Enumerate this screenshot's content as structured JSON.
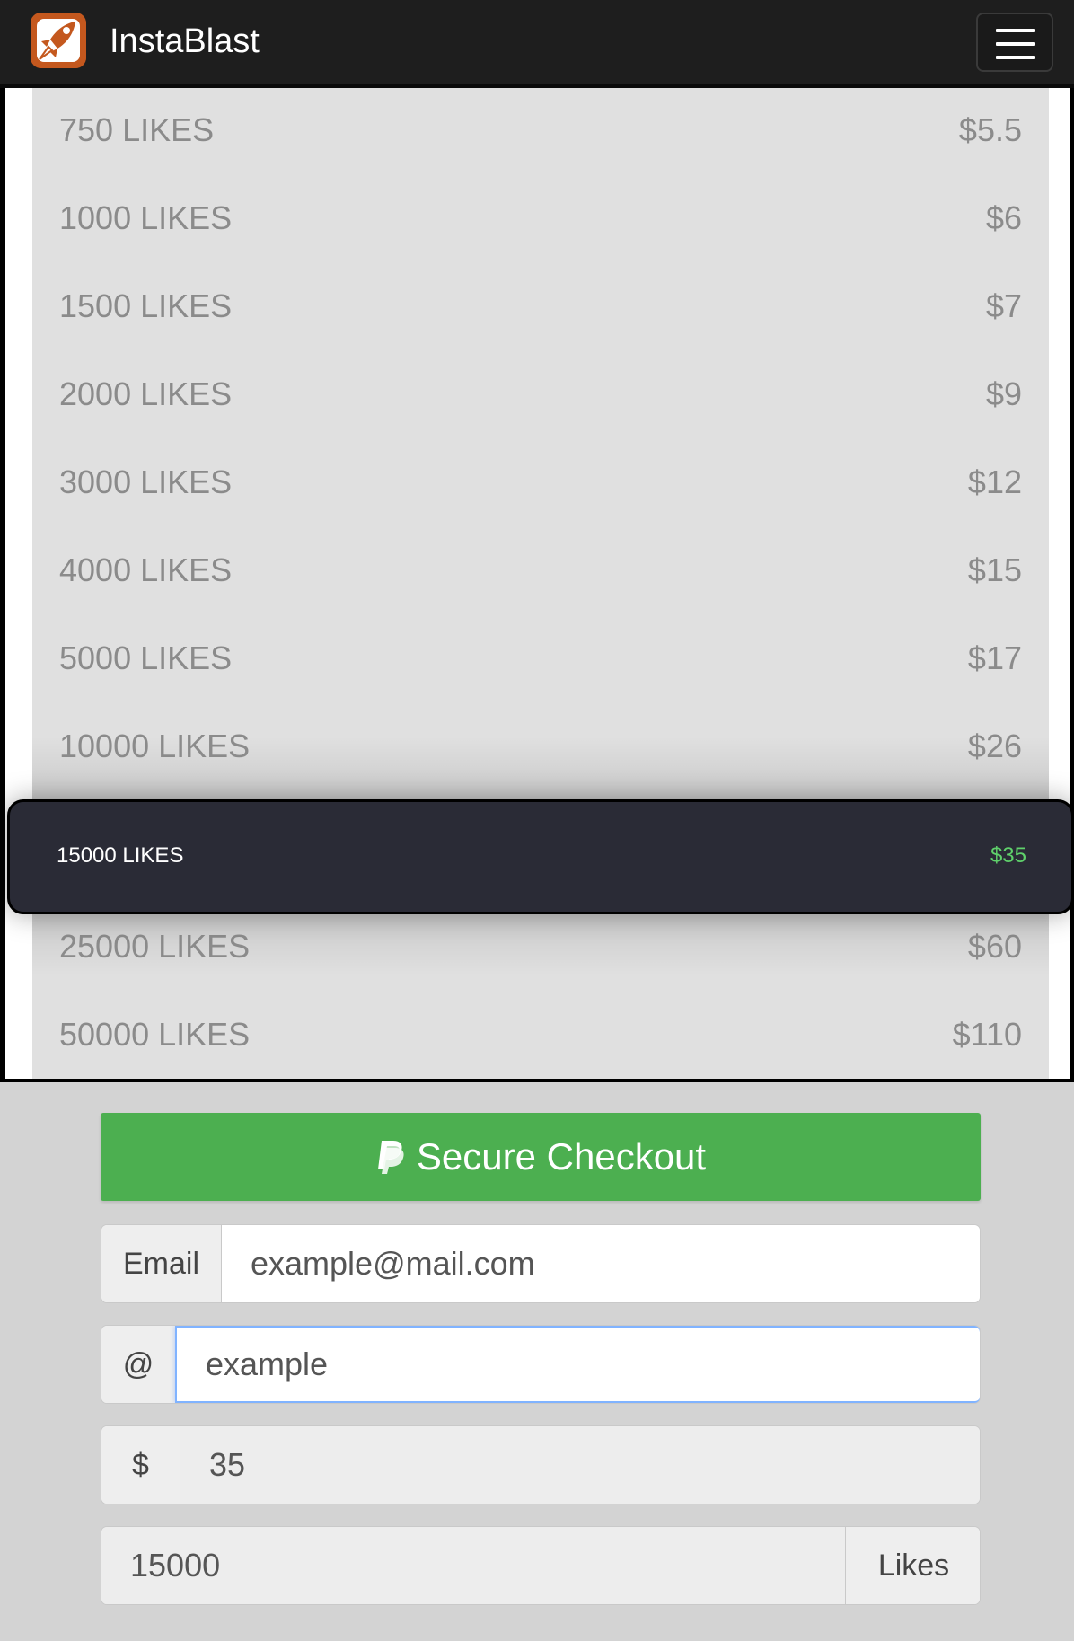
{
  "navbar": {
    "brand": "InstaBlast",
    "logo_icon": "rocket-logo-icon",
    "menu_icon": "hamburger-menu-icon",
    "logo_color": "#c4581e"
  },
  "packages": [
    {
      "quantity": "750 LIKES",
      "price": "$5.5"
    },
    {
      "quantity": "1000 LIKES",
      "price": "$6"
    },
    {
      "quantity": "1500 LIKES",
      "price": "$7"
    },
    {
      "quantity": "2000 LIKES",
      "price": "$9"
    },
    {
      "quantity": "3000 LIKES",
      "price": "$12"
    },
    {
      "quantity": "4000 LIKES",
      "price": "$15"
    },
    {
      "quantity": "5000 LIKES",
      "price": "$17"
    },
    {
      "quantity": "10000 LIKES",
      "price": "$26"
    },
    {
      "quantity": "25000 LIKES",
      "price": "$60"
    },
    {
      "quantity": "50000 LIKES",
      "price": "$110"
    }
  ],
  "selected_package": {
    "quantity": "15000 LIKES",
    "price": "$35",
    "price_color": "#5fd16b"
  },
  "checkout": {
    "button_label": "Secure Checkout",
    "button_icon": "paypal-icon",
    "button_color": "#4caf50",
    "email": {
      "addon": "Email",
      "value": "example@mail.com"
    },
    "username": {
      "addon": "@",
      "value": "example"
    },
    "price": {
      "addon": "$",
      "value": "35"
    },
    "likes": {
      "value": "15000",
      "addon": "Likes"
    }
  }
}
